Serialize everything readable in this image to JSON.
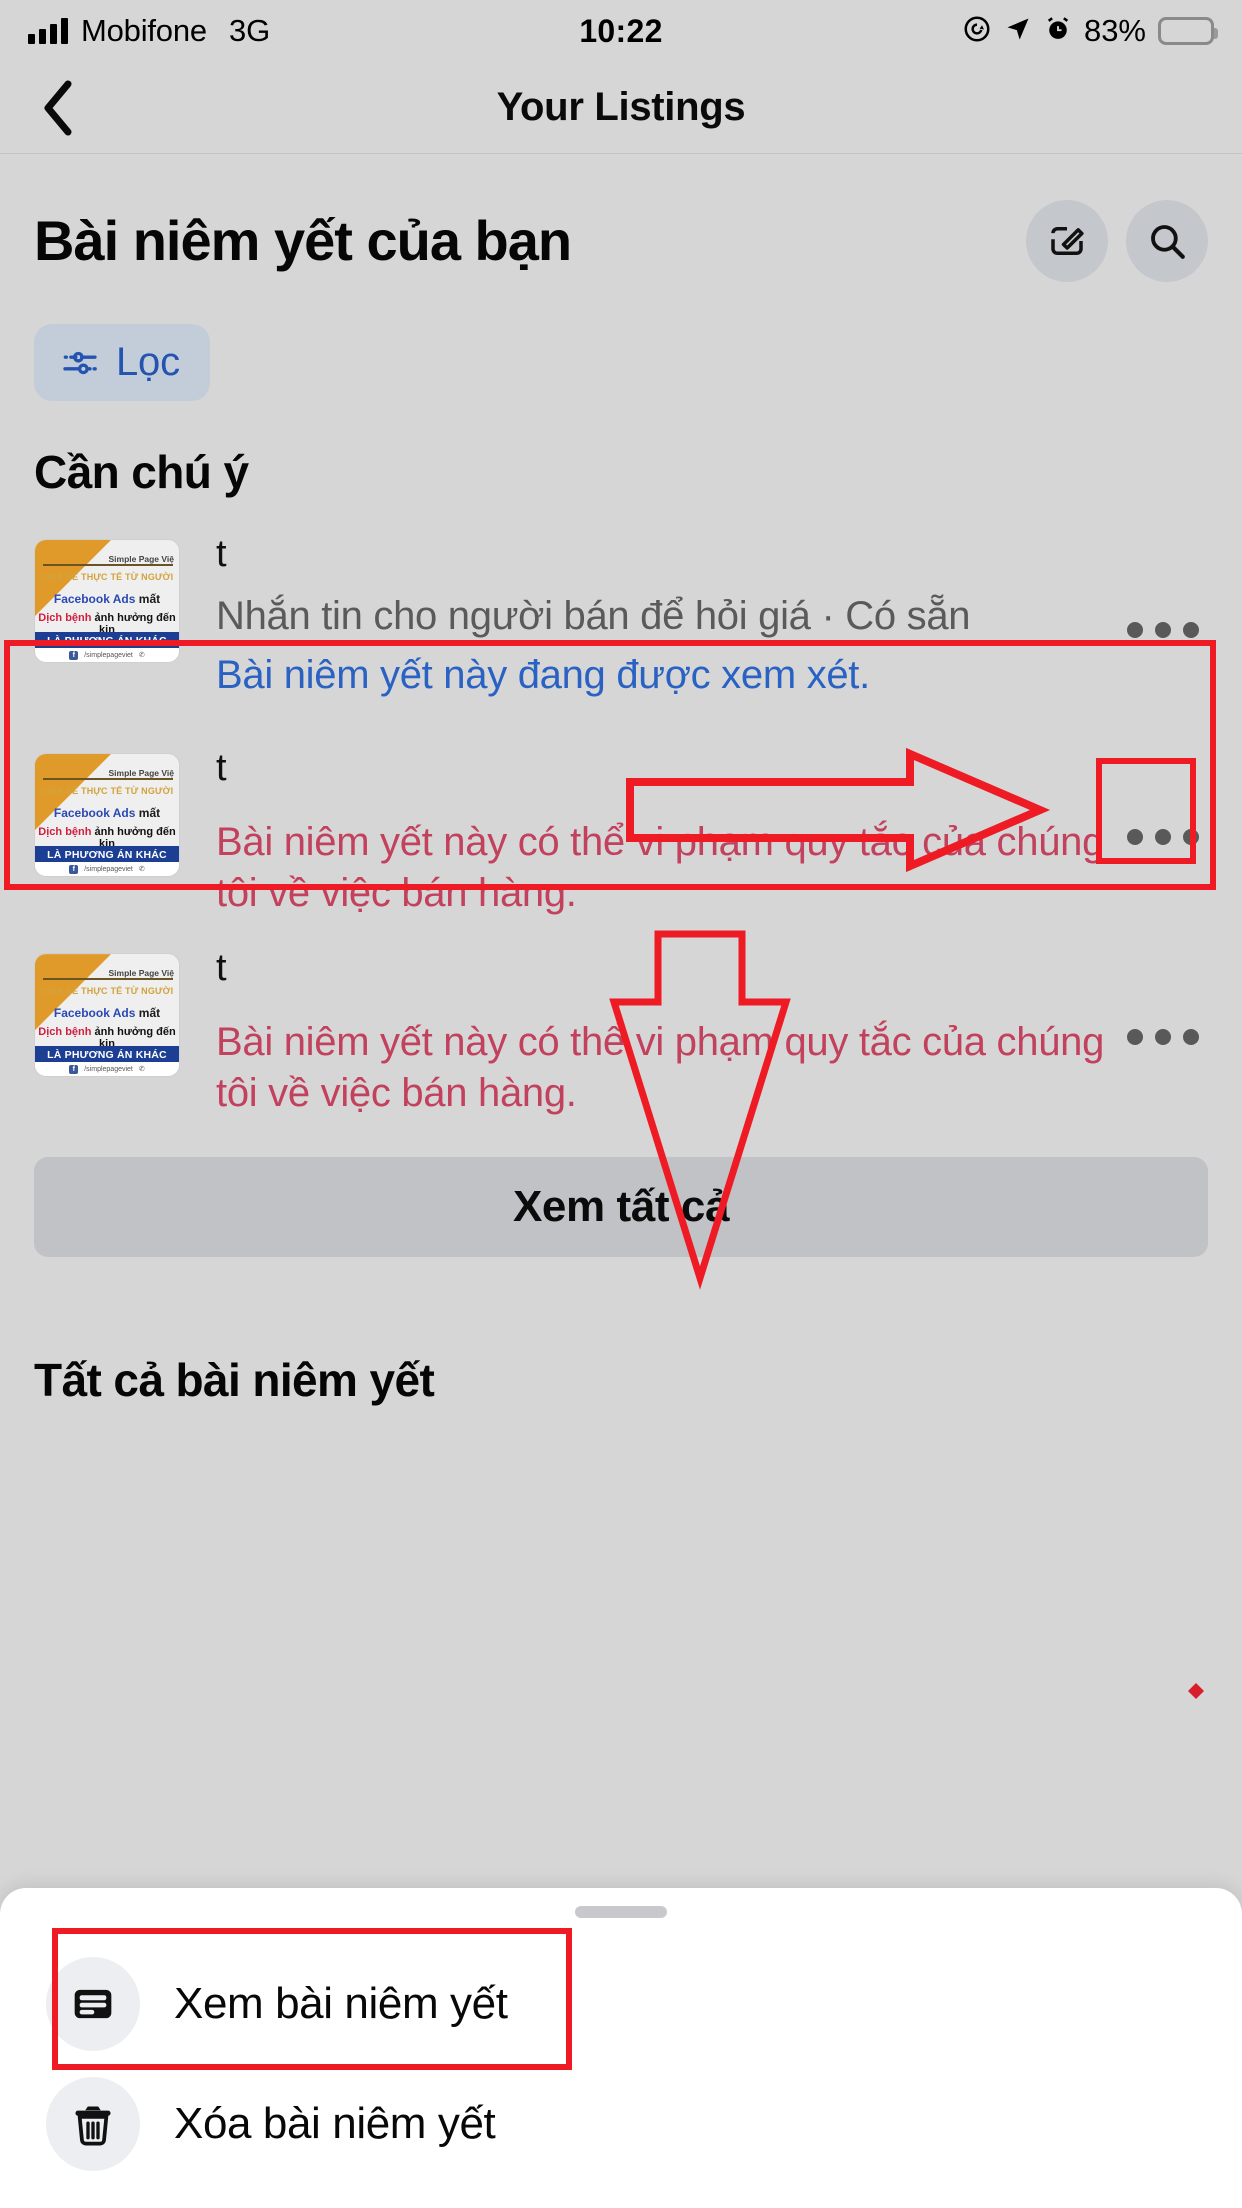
{
  "status_bar": {
    "carrier": "Mobifone",
    "network": "3G",
    "time": "10:22",
    "battery_percent": "83%",
    "battery_level": 83,
    "icons": [
      "rotation-lock-icon",
      "location-arrow-icon",
      "alarm-clock-icon",
      "battery-icon"
    ]
  },
  "nav": {
    "back_icon": "chevron-left-icon",
    "title": "Your Listings"
  },
  "header": {
    "title": "Bài niêm yết của bạn",
    "compose_icon": "compose-edit-icon",
    "search_icon": "search-icon"
  },
  "filter": {
    "label": "Lọc",
    "icon": "sliders-filter-icon"
  },
  "sections": [
    {
      "heading": "Cần chú ý",
      "see_all_label": "Xem tất cả",
      "listings": [
        {
          "title": "t",
          "subtitle": "Nhắn tin cho người bán để hỏi giá · Có sẵn",
          "status": "Bài niêm yết này đang được xem xét.",
          "status_type": "review",
          "menu_icon": "more-options-icon"
        },
        {
          "title": "t",
          "warning": "Bài niêm yết này có thể vi phạm quy tắc của chúng tôi về việc bán hàng.",
          "status_type": "violation",
          "menu_icon": "more-options-icon"
        },
        {
          "title": "t",
          "warning": "Bài niêm yết này có thể vi phạm quy tắc của chúng tôi về việc bán hàng.",
          "status_type": "violation",
          "menu_icon": "more-options-icon"
        }
      ]
    },
    {
      "heading": "Tất cả bài niêm yết",
      "listings": []
    }
  ],
  "thumbnail": {
    "brand": "Simple Page Việ",
    "tagline": "CHIA SẺ THỰC TẾ TỪ NGƯỜI",
    "line_blue": "Facebook Ads",
    "line_blue_rest": " mất",
    "line_red": "Dịch bệnh",
    "line_red_rest": " ảnh hưởng đến kin",
    "band": "LÀ PHƯƠNG ÁN KHÁC",
    "footer_handle": "/simplepageviet"
  },
  "bottom_sheet": {
    "grabber": "sheet-grabber",
    "items": [
      {
        "label": "Xem bài niêm yết",
        "icon": "view-listing-card-icon"
      },
      {
        "label": "Xóa bài niêm yết",
        "icon": "trash-delete-icon"
      }
    ]
  },
  "annotations": {
    "color": "#ee1b24",
    "shapes": [
      "highlight-box-listing-1",
      "arrow-right-to-menu",
      "highlight-box-menu-button",
      "arrow-down-to-sheet",
      "highlight-box-view-listing",
      "diamond-marker"
    ]
  },
  "colors": {
    "background": "#d6d6d6",
    "accent_blue": "#2554b0",
    "status_blue": "#2a62c4",
    "warning_red": "#c2415c",
    "annotation_red": "#ee1b24",
    "sheet_white": "#ffffff"
  }
}
